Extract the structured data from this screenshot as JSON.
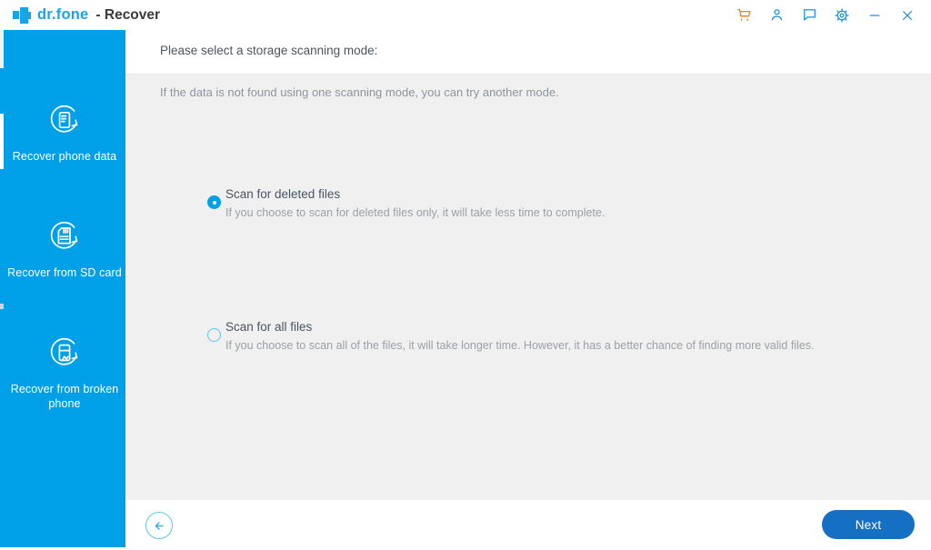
{
  "window": {
    "brand_primary": "dr.fone",
    "brand_secondary": "- Recover",
    "logo_icon": "drfone-plus-logo-icon",
    "accent_color": "#00a0e9",
    "button_color": "#1570c4",
    "cart_color": "#f08122",
    "actions": [
      {
        "name": "cart-icon",
        "label": "Cart"
      },
      {
        "name": "account-icon",
        "label": "Account"
      },
      {
        "name": "feedback-icon",
        "label": "Feedback"
      },
      {
        "name": "settings-gear-icon",
        "label": "Settings"
      },
      {
        "name": "minimize-icon",
        "label": "Minimize"
      },
      {
        "name": "close-icon",
        "label": "Close"
      }
    ]
  },
  "sidebar": {
    "items": [
      {
        "label": "Recover phone data",
        "icon": "phone-recover-icon",
        "active": true
      },
      {
        "label": "Recover from SD card",
        "icon": "sdcard-recover-icon",
        "active": false
      },
      {
        "label": "Recover from broken phone",
        "icon": "broken-phone-recover-icon",
        "active": false
      }
    ]
  },
  "main": {
    "header_title": "Please select a storage scanning mode:",
    "hint": "If the data is not found using one scanning mode, you can try another mode.",
    "options": [
      {
        "title": "Scan for deleted files",
        "description": "If you choose to scan for deleted files only, it will take less time to complete.",
        "selected": true
      },
      {
        "title": "Scan for all files",
        "description": "If you choose to scan all of the files, it will take longer time. However, it has a better chance of finding more valid files.",
        "selected": false
      }
    ]
  },
  "footer": {
    "back_label": "Back",
    "back_icon": "arrow-left-icon",
    "next_label": "Next"
  }
}
